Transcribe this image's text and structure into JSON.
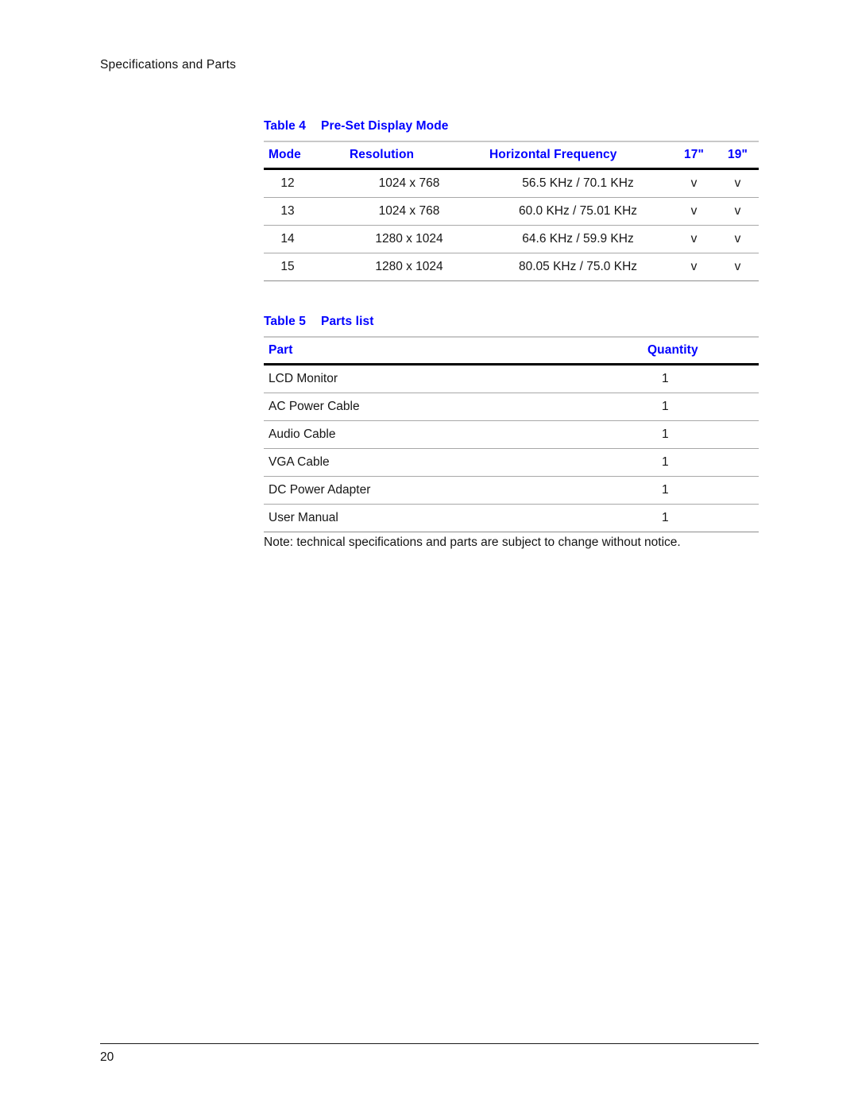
{
  "page": {
    "running_header": "Specifications and Parts",
    "page_number": "20"
  },
  "table4": {
    "caption_number": "Table 4",
    "caption_title": "Pre-Set Display Mode",
    "columns": [
      "Mode",
      "Resolution",
      "Horizontal Frequency",
      "17\"",
      "19\""
    ],
    "rows": [
      {
        "mode": "12",
        "resolution": "1024 x 768",
        "frequency": "56.5 KHz / 70.1 KHz",
        "size17": "v",
        "size19": "v"
      },
      {
        "mode": "13",
        "resolution": "1024 x 768",
        "frequency": "60.0 KHz / 75.01 KHz",
        "size17": "v",
        "size19": "v"
      },
      {
        "mode": "14",
        "resolution": "1280 x 1024",
        "frequency": "64.6 KHz / 59.9 KHz",
        "size17": "v",
        "size19": "v"
      },
      {
        "mode": "15",
        "resolution": "1280 x 1024",
        "frequency": "80.05 KHz / 75.0 KHz",
        "size17": "v",
        "size19": "v"
      }
    ]
  },
  "table5": {
    "caption_number": "Table 5",
    "caption_title": "Parts list",
    "columns": [
      "Part",
      "Quantity"
    ],
    "rows": [
      {
        "part": "LCD Monitor",
        "quantity": "1"
      },
      {
        "part": "AC Power Cable",
        "quantity": "1"
      },
      {
        "part": "Audio Cable",
        "quantity": "1"
      },
      {
        "part": "VGA Cable",
        "quantity": "1"
      },
      {
        "part": "DC Power Adapter",
        "quantity": "1"
      },
      {
        "part": "User Manual",
        "quantity": "1"
      }
    ],
    "note": "Note: technical specifications and parts are subject to change without notice."
  },
  "colors": {
    "heading_blue": "#0000ff",
    "body_text": "#161616",
    "rule_gray": "#a8a8a8",
    "rule_black": "#000000"
  }
}
